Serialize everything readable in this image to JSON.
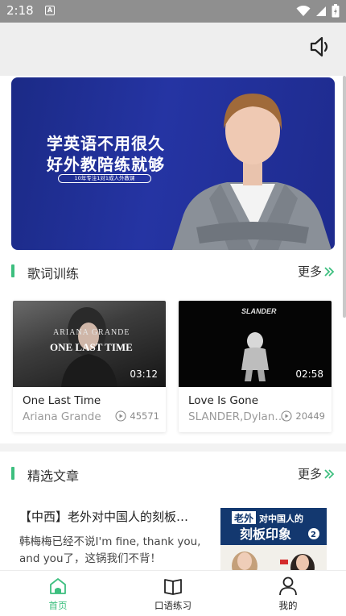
{
  "status_bar": {
    "time": "2:18",
    "icons": [
      "a-notification-icon",
      "wifi-icon",
      "signal-icon",
      "battery-icon"
    ]
  },
  "header": {
    "icons": [
      "speaker-icon"
    ]
  },
  "banner": {
    "line1": "学英语不用很久",
    "line2": "好外教陪练就够",
    "tagline": "10年专注1对1成人外教课"
  },
  "lyrics_section": {
    "title": "歌词训练",
    "more": "更多"
  },
  "videos": [
    {
      "thumb_text_1": "ARIANA GRANDE",
      "thumb_text_2": "ONE LAST TIME",
      "duration": "03:12",
      "title": "One Last Time",
      "artist": "Ariana Grande",
      "plays": "45571"
    },
    {
      "thumb_text_1": "SLANDER",
      "duration": "02:58",
      "title": "Love Is Gone",
      "artist": "SLANDER,Dylan…",
      "plays": "20449"
    }
  ],
  "articles_section": {
    "title": "精选文章",
    "more": "更多"
  },
  "article": {
    "title": "【中西】老外对中国人的刻板…",
    "summary": "韩梅梅已经不说I'm fine, thank you, and you了，这锅我们不背！",
    "thumb_text_1": "老外",
    "thumb_text_2": "对中国人的",
    "thumb_text_3": "刻板印象",
    "thumb_badge": "2"
  },
  "bottom_nav": [
    {
      "label": "首页",
      "icon": "home-icon",
      "active": true
    },
    {
      "label": "口语练习",
      "icon": "book-icon",
      "active": false
    },
    {
      "label": "我的",
      "icon": "person-icon",
      "active": false
    }
  ],
  "colors": {
    "accent": "#3dbf7f",
    "banner_bg": "#2534a3",
    "header_bg": "#eeeeee",
    "status_bar_bg": "#8f8f8f"
  }
}
